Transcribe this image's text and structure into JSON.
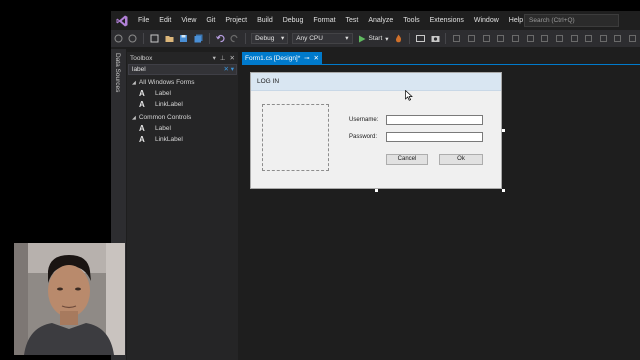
{
  "menu": {
    "items": [
      "File",
      "Edit",
      "View",
      "Git",
      "Project",
      "Build",
      "Debug",
      "Format",
      "Test",
      "Analyze",
      "Tools",
      "Extensions",
      "Window",
      "Help"
    ],
    "search_placeholder": "Search (Ctrl+Q)"
  },
  "toolbar": {
    "config": "Debug",
    "platform": "Any CPU",
    "start_label": "Start"
  },
  "side_strip": {
    "label": "Data Sources"
  },
  "toolbox": {
    "title": "Toolbox",
    "search_value": "label",
    "groups": [
      {
        "name": "All Windows Forms",
        "items": [
          "Label",
          "LinkLabel"
        ]
      },
      {
        "name": "Common Controls",
        "items": [
          "Label",
          "LinkLabel"
        ]
      }
    ]
  },
  "tab": {
    "label": "Form1.cs [Design]*"
  },
  "form": {
    "title": "LOG IN",
    "username_label": "Username:",
    "password_label": "Password:",
    "cancel_label": "Cancel",
    "ok_label": "Ok"
  },
  "colors": {
    "accent": "#007acc",
    "menu_bg": "#1f1f1f",
    "editor_bg": "#1e1e1e"
  }
}
